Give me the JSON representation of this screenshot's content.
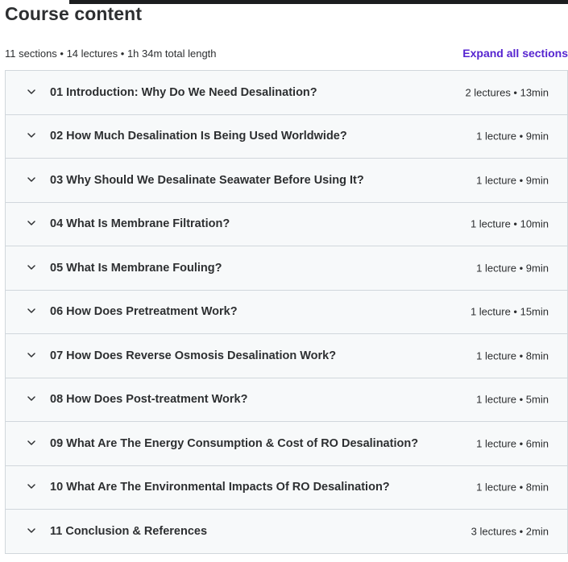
{
  "header": {
    "title": "Course content",
    "summary": "11 sections • 14 lectures • 1h 34m total length",
    "expand_all_label": "Expand all sections"
  },
  "sections": [
    {
      "title": "01 Introduction: Why Do We Need Desalination?",
      "meta": "2 lectures • 13min"
    },
    {
      "title": "02 How Much Desalination Is Being Used Worldwide?",
      "meta": "1 lecture • 9min"
    },
    {
      "title": "03 Why Should We Desalinate Seawater Before Using It?",
      "meta": "1 lecture • 9min"
    },
    {
      "title": "04 What Is Membrane Filtration?",
      "meta": "1 lecture • 10min"
    },
    {
      "title": "05 What Is Membrane Fouling?",
      "meta": "1 lecture • 9min"
    },
    {
      "title": "06 How Does Pretreatment Work?",
      "meta": "1 lecture • 15min"
    },
    {
      "title": "07 How Does Reverse Osmosis Desalination Work?",
      "meta": "1 lecture • 8min"
    },
    {
      "title": "08 How Does Post-treatment Work?",
      "meta": "1 lecture • 5min"
    },
    {
      "title": "09 What Are The Energy Consumption & Cost of RO Desalination?",
      "meta": "1 lecture • 6min"
    },
    {
      "title": "10 What Are The Environmental Impacts Of RO Desalination?",
      "meta": "1 lecture • 8min"
    },
    {
      "title": "11 Conclusion & References",
      "meta": "3 lectures • 2min"
    }
  ],
  "icons": {
    "section_toggle": "chevron-down-icon"
  },
  "colors": {
    "accent": "#5624d0",
    "section_bg": "#f7f9fa",
    "border": "#d1d7dc",
    "text": "#2d2f31"
  }
}
